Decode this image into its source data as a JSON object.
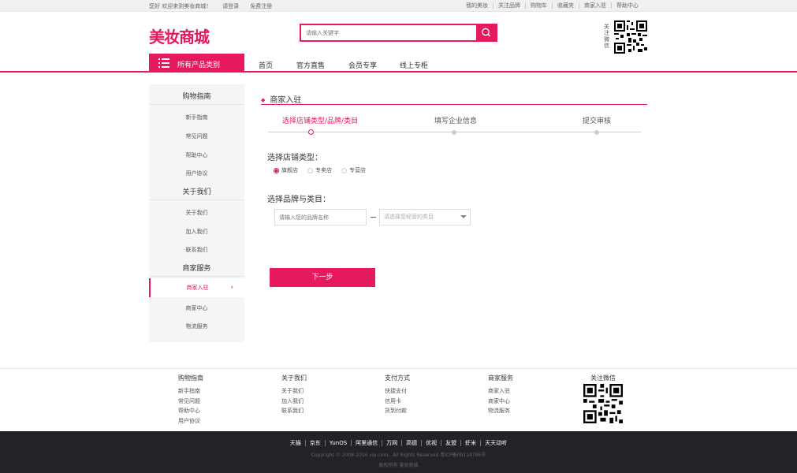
{
  "topbar": {
    "welcome": "您好 欢迎来到美妆商城！",
    "login": "请登录",
    "register": "免费注册",
    "links": [
      "我的美妆",
      "关注品牌",
      "购物车",
      "收藏夹",
      "商家入驻",
      "帮助中心"
    ]
  },
  "header": {
    "logo": "美妆商城",
    "search_placeholder": "请输入关键字",
    "follow_label": "关注微信"
  },
  "nav": {
    "categories_label": "所有产品类别",
    "items": [
      "首页",
      "官方直售",
      "会员专享",
      "线上专柜"
    ]
  },
  "sidebar": {
    "groups": [
      {
        "title": "购物指南",
        "items": [
          "新手指南",
          "常见问题",
          "帮助中心",
          "用户协议"
        ]
      },
      {
        "title": "关于我们",
        "items": [
          "关于我们",
          "加入我们",
          "联系我们"
        ]
      },
      {
        "title": "商家服务",
        "items": [
          "商家入驻",
          "商家中心",
          "物流服务"
        ]
      }
    ]
  },
  "main": {
    "title": "商家入驻",
    "steps": [
      "选择店铺类型/品牌/类目",
      "填写企业信息",
      "提交审核"
    ],
    "store_type_label": "选择店铺类型：",
    "store_types": [
      "旗舰店",
      "专卖店",
      "专营店"
    ],
    "brand_label": "选择品牌与类目：",
    "brand_placeholder": "请输入您的品牌名称",
    "category_placeholder": "请选择您经营的类目",
    "next_button": "下一步"
  },
  "footer": {
    "columns": [
      {
        "title": "购物指南",
        "items": [
          "新手指南",
          "常见问题",
          "帮助中心",
          "用户协议"
        ]
      },
      {
        "title": "关于我们",
        "items": [
          "关于我们",
          "加入我们",
          "联系我们"
        ]
      },
      {
        "title": "支付方式",
        "items": [
          "快捷支付",
          "信用卡",
          "货到付款"
        ]
      },
      {
        "title": "商家服务",
        "items": [
          "商家入驻",
          "商家中心",
          "物流服务"
        ]
      }
    ],
    "wechat_label": "关注微信",
    "links": [
      "天猫",
      "京东",
      "YunOS",
      "阿里通信",
      "万网",
      "高德",
      "优视",
      "友盟",
      "虾米",
      "天天动听"
    ],
    "copyright": "Copyright © 2008-2016 vip.com，All Rights Reserved 粤ICP备08114786号",
    "rights": "版权所有  美妆商城"
  },
  "colors": {
    "accent": "#e6195c",
    "footer_bg": "#222327"
  }
}
